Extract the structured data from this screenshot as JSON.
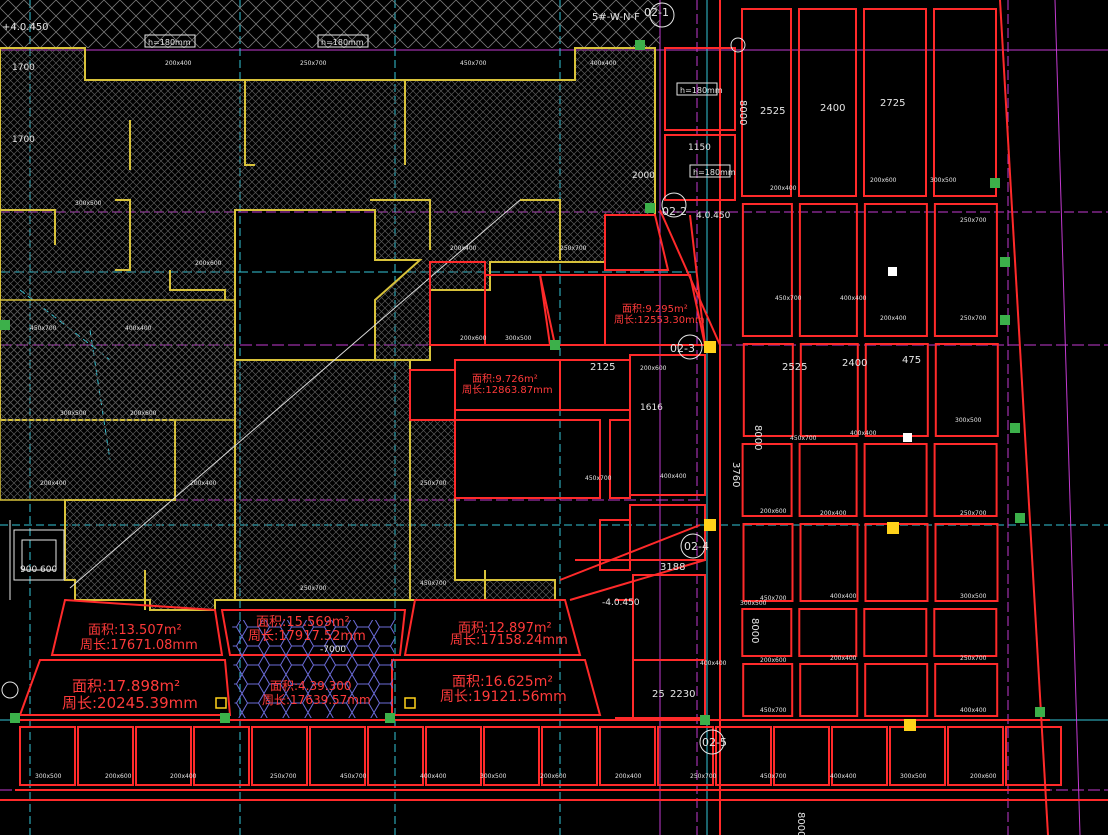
{
  "drawing": {
    "top_level": "+4.0.450",
    "mid_level": "4.0.450",
    "right_level": "-4.0.450",
    "thickness_labels": [
      "h=180mm",
      "h=180mm",
      "h=180mm",
      "h=180mm"
    ],
    "sheet_mark": "5#-W-N-F",
    "axes": {
      "a1": "02-1",
      "a2": "02-2",
      "a3": "02-3",
      "a4": "02-4",
      "a5": "02-5"
    },
    "dims": {
      "d2525a": "2525",
      "d2400a": "2400",
      "d2725": "2725",
      "d2525b": "2525",
      "d2400b": "2400",
      "d475": "475",
      "d2125": "2125",
      "d3188": "3188",
      "d2230": "2230",
      "d1616": "1616",
      "d8000a": "8000",
      "d8000b": "8000",
      "d8000c": "8000",
      "d8000d": "8000",
      "d3760": "3760",
      "d900": "900",
      "d600": "600",
      "d1700a": "1700",
      "d1700b": "1700",
      "d1150": "1150",
      "d2000": "2000",
      "d25": "25",
      "d7000": "-7000"
    },
    "small_area_a": "面积:9.295m²",
    "small_perim_a": "周长:12553.30mm",
    "small_area_b": "面积:9.726m²",
    "small_perim_b": "周长:12863.87mm",
    "areas": [
      {
        "area": "面积:13.507m²",
        "perimeter": "周长:17671.08mm"
      },
      {
        "area": "面积:15.569m²",
        "perimeter": "周长:17917.52mm"
      },
      {
        "area": "面积:12.897m²",
        "perimeter": "周长:17158.24mm"
      },
      {
        "area": "面积:17.898m²",
        "perimeter": "周长:20245.39mm"
      },
      {
        "area": "面积:4.39.300",
        "perimeter": "周长:17639.57mm"
      },
      {
        "area": "面积:16.625m²",
        "perimeter": "周长:19121.56mm"
      }
    ],
    "beam_tags": {
      "b1": "200x400",
      "b2": "250x700",
      "b3": "450x700",
      "b4": "400x400",
      "b5": "300x500",
      "b6": "200x600"
    },
    "colors": {
      "background": "#000000",
      "slab_line": "#ff2a2a",
      "wall_outline": "#d8c23a",
      "grid_cyan": "#35c6d8",
      "grid_magenta": "#c23ad0",
      "hatch": "#5a5a5a",
      "column_green": "#3cb04a",
      "column_yellow": "#ffd21a",
      "text_white": "#e6e6e6",
      "hex_blue": "#6b6bd8"
    }
  }
}
